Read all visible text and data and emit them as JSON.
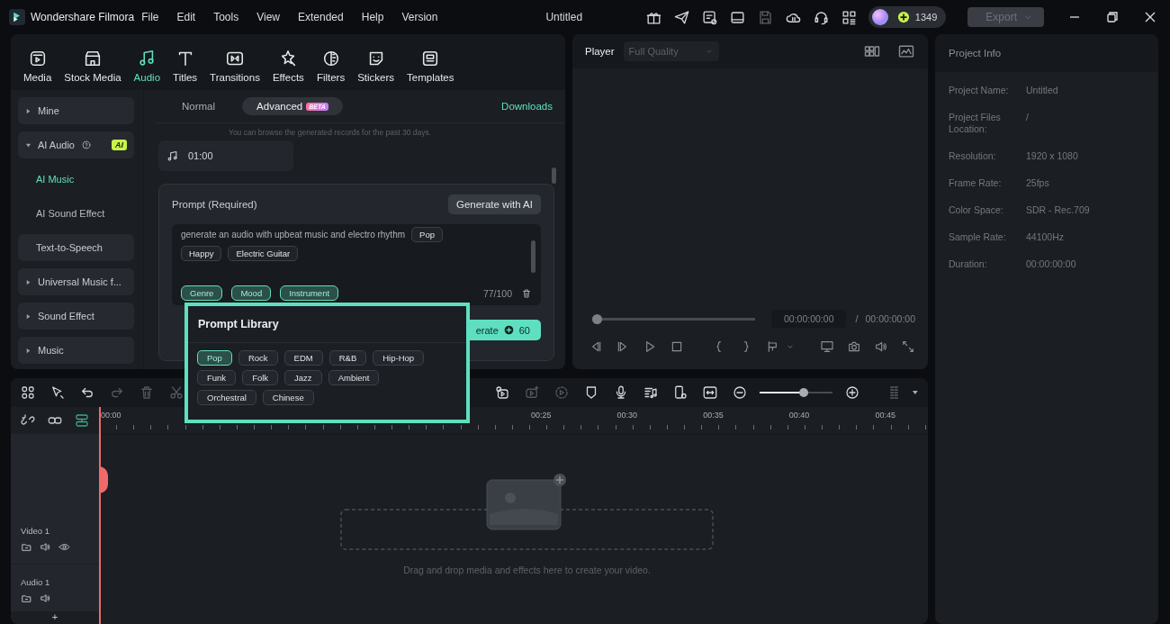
{
  "app": {
    "name": "Wondershare Filmora",
    "menus": [
      "File",
      "Edit",
      "Tools",
      "View",
      "Extended",
      "Help",
      "Version"
    ],
    "title": "Untitled",
    "credits": "1349",
    "export": {
      "label": "Export",
      "disabled": true
    },
    "save_disabled": true
  },
  "media_tabs": [
    {
      "label": "Media",
      "selected": false
    },
    {
      "label": "Stock Media",
      "selected": false
    },
    {
      "label": "Audio",
      "selected": true
    },
    {
      "label": "Titles",
      "selected": false
    },
    {
      "label": "Transitions",
      "selected": false
    },
    {
      "label": "Effects",
      "selected": false
    },
    {
      "label": "Filters",
      "selected": false
    },
    {
      "label": "Stickers",
      "selected": false
    },
    {
      "label": "Templates",
      "selected": false
    }
  ],
  "sidebar": {
    "items": [
      {
        "label": "Mine",
        "kind": "group",
        "expanded": false
      },
      {
        "label": "AI Audio",
        "kind": "group",
        "expanded": true,
        "badge": "AI",
        "children": [
          {
            "label": "AI Music",
            "selected": true
          },
          {
            "label": "AI Sound Effect",
            "selected": false
          }
        ]
      },
      {
        "label": "Text-to-Speech",
        "kind": "item"
      },
      {
        "label": "Universal Music f...",
        "kind": "group",
        "expanded": false
      },
      {
        "label": "Sound Effect",
        "kind": "group",
        "expanded": false
      },
      {
        "label": "Music",
        "kind": "group",
        "expanded": false
      }
    ]
  },
  "mode_tabs": [
    {
      "label": "Normal",
      "selected": false
    },
    {
      "label": "Advanced",
      "selected": true,
      "badge": "BETA"
    }
  ],
  "downloads": "Downloads",
  "note": "You can browse the generated records for the past 30 days.",
  "record": {
    "duration": "01:00"
  },
  "prompt": {
    "title": "Prompt (Required)",
    "ai_button": "Generate with AI",
    "text": "generate an audio with upbeat music and electro rhythm",
    "chips": [
      "Pop",
      "Happy",
      "Electric Guitar"
    ],
    "categories": [
      "Genre",
      "Mood",
      "Instrument"
    ],
    "count": "77/100",
    "generate_label": "erate",
    "cost": "60"
  },
  "prompt_library": {
    "title": "Prompt Library",
    "tags": [
      {
        "label": "Pop",
        "selected": true
      },
      {
        "label": "Rock",
        "selected": false
      },
      {
        "label": "EDM",
        "selected": false
      },
      {
        "label": "R&B",
        "selected": false
      },
      {
        "label": "Hip-Hop",
        "selected": false
      },
      {
        "label": "Funk",
        "selected": false
      },
      {
        "label": "Folk",
        "selected": false
      },
      {
        "label": "Jazz",
        "selected": false
      },
      {
        "label": "Ambient",
        "selected": false
      },
      {
        "label": "Orchestral",
        "selected": false
      },
      {
        "label": "Chinese",
        "selected": false
      }
    ]
  },
  "player": {
    "title": "Player",
    "quality": "Full Quality",
    "current": "00:00:00:00",
    "separator": "/",
    "total": "00:00:00:00",
    "progress": {
      "level": 0
    }
  },
  "project_info": {
    "title": "Project Info",
    "rows": [
      {
        "label": "Project Name:",
        "value": "Untitled"
      },
      {
        "label": "Project Files Location:",
        "value": "/"
      },
      {
        "label": "Resolution:",
        "value": "1920 x 1080"
      },
      {
        "label": "Frame Rate:",
        "value": "25fps"
      },
      {
        "label": "Color Space:",
        "value": "SDR - Rec.709"
      },
      {
        "label": "Sample Rate:",
        "value": "44100Hz"
      },
      {
        "label": "Duration:",
        "value": "00:00:00:00"
      }
    ]
  },
  "timeline": {
    "tools": [
      {
        "disabled": false
      },
      {
        "disabled": false
      },
      {
        "disabled": false
      },
      {
        "disabled": true
      },
      {
        "disabled": true
      },
      {
        "disabled": true
      },
      {
        "disabled": false
      },
      {
        "disabled": true
      },
      {
        "disabled": true
      },
      {
        "disabled": false
      },
      {
        "disabled": false
      },
      {
        "disabled": false
      },
      {
        "disabled": false
      },
      {
        "disabled": false
      }
    ],
    "zoom": {
      "level": 0.6
    },
    "ruler": [
      "00:00",
      "00:25",
      "00:30",
      "00:35",
      "00:40",
      "00:45"
    ],
    "tracks": [
      {
        "name": "Video 1",
        "kind": "video"
      },
      {
        "name": "Audio 1",
        "kind": "audio"
      }
    ],
    "hint": "Drag and drop media and effects here to create your video.",
    "add": "+"
  }
}
